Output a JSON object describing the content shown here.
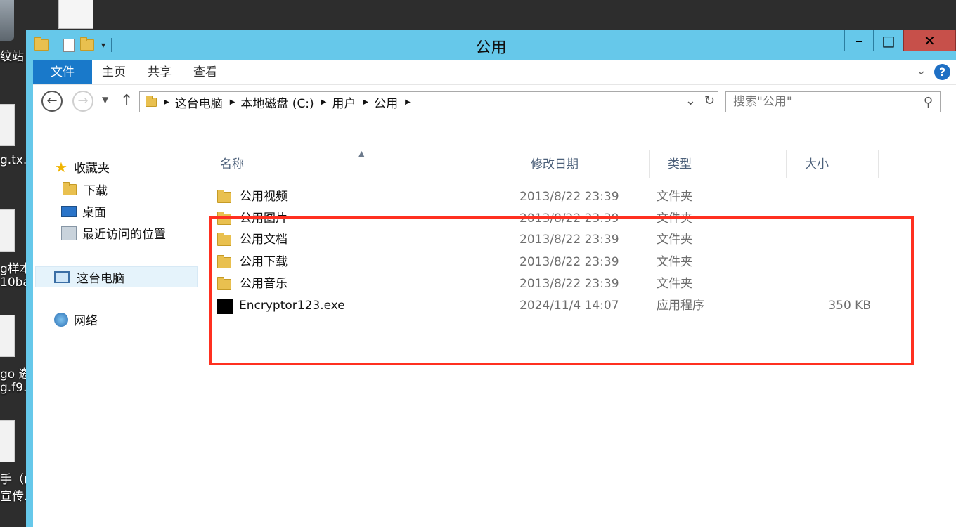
{
  "desktop": {
    "labels": [
      "纹站",
      "g.tx...",
      "g样本",
      "10ba",
      "go 邀",
      "g.f9...",
      "手（山",
      "宣传..."
    ]
  },
  "window": {
    "title": "公用",
    "min_label": "–",
    "max_label": "□",
    "close_label": "✕"
  },
  "ribbon": {
    "tabs": [
      "文件",
      "主页",
      "共享",
      "查看"
    ],
    "help_label": "?"
  },
  "navbar": {
    "back": "←",
    "forward": "→",
    "up": "↑",
    "breadcrumbs": [
      "这台电脑",
      "本地磁盘 (C:)",
      "用户",
      "公用"
    ],
    "search_placeholder": "搜索\"公用\""
  },
  "navpane": {
    "favorites": "收藏夹",
    "downloads": "下载",
    "desktop": "桌面",
    "recent": "最近访问的位置",
    "this_pc": "这台电脑",
    "network": "网络"
  },
  "columns": {
    "name": "名称",
    "modified": "修改日期",
    "type": "类型",
    "size": "大小"
  },
  "files": [
    {
      "name": "公用视频",
      "modified": "2013/8/22 23:39",
      "type": "文件夹",
      "size": "",
      "icon": "folder-icon"
    },
    {
      "name": "公用图片",
      "modified": "2013/8/22 23:39",
      "type": "文件夹",
      "size": "",
      "icon": "folder-icon"
    },
    {
      "name": "公用文档",
      "modified": "2013/8/22 23:39",
      "type": "文件夹",
      "size": "",
      "icon": "folder-icon"
    },
    {
      "name": "公用下载",
      "modified": "2013/8/22 23:39",
      "type": "文件夹",
      "size": "",
      "icon": "folder-icon"
    },
    {
      "name": "公用音乐",
      "modified": "2013/8/22 23:39",
      "type": "文件夹",
      "size": "",
      "icon": "folder-icon"
    },
    {
      "name": "Encryptor123.exe",
      "modified": "2024/11/4 14:07",
      "type": "应用程序",
      "size": "350 KB",
      "icon": "exe-icon"
    }
  ],
  "colors": {
    "window_frame": "#66c8ea",
    "file_tab": "#1979ca",
    "close_button": "#c7504a",
    "highlight_box": "#ff3020"
  }
}
